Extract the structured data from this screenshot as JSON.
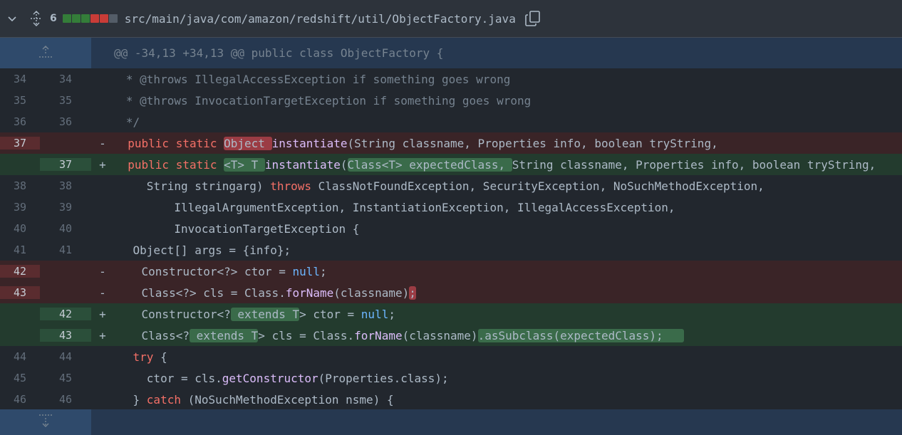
{
  "header": {
    "change_count": "6",
    "diffstat": [
      "#347d39",
      "#347d39",
      "#347d39",
      "#c93c37",
      "#c93c37",
      "#545d68"
    ],
    "file_path": "src/main/java/com/amazon/redshift/util/ObjectFactory.java",
    "icons": [
      "chevron-down-icon",
      "unfold-icon",
      "copy-icon"
    ]
  },
  "hunk": {
    "header": "@@ -34,13 +34,13 @@ public class ObjectFactory {",
    "expand_up_icon": "fold-up-icon",
    "expand_down_icon": "fold-down-icon"
  },
  "lines": {
    "l34": {
      "old": "34",
      "new": "34",
      "text": "   * @throws IllegalAccessException if something goes wrong"
    },
    "l35": {
      "old": "35",
      "new": "35",
      "text": "   * @throws InvocationTargetException if something goes wrong"
    },
    "l36": {
      "old": "36",
      "new": "36",
      "text": "   */"
    },
    "d37": {
      "old": "37",
      "marker": "-",
      "p1": "  public static ",
      "p2": "Object ",
      "p3": "instantiate",
      "p4": "(String classname, Properties info, boolean tryString,"
    },
    "a37": {
      "new": "37",
      "marker": "+",
      "p1": "  public static ",
      "p2": "<T> T ",
      "p3": "instantiate",
      "p4": "(",
      "p5": "Class<T> expectedClass, ",
      "p6": "String classname, Properties info, boolean tryString,"
    },
    "l38": {
      "old": "38",
      "new": "38",
      "p1": "      String stringarg) ",
      "p2": "throws",
      "p3": " ClassNotFoundException, SecurityException, NoSuchMethodException,"
    },
    "l39": {
      "old": "39",
      "new": "39",
      "text": "          IllegalArgumentException, InstantiationException, IllegalAccessException,"
    },
    "l40": {
      "old": "40",
      "new": "40",
      "text": "          InvocationTargetException {"
    },
    "l41": {
      "old": "41",
      "new": "41",
      "text": "    Object[] args = {info};"
    },
    "d42": {
      "old": "42",
      "marker": "-",
      "p1": "    Constructor<?> ctor = ",
      "p2": "null",
      "p3": ";"
    },
    "d43": {
      "old": "43",
      "marker": "-",
      "p1": "    Class<?> cls = Class.",
      "p2": "forName",
      "p3": "(classname)",
      "p4": ";"
    },
    "a42": {
      "new": "42",
      "marker": "+",
      "p1": "    Constructor<?",
      "p2": " extends T",
      "p3": "> ctor = ",
      "p4": "null",
      "p5": ";"
    },
    "a43": {
      "new": "43",
      "marker": "+",
      "p1": "    Class<?",
      "p2": " extends T",
      "p3": "> cls = Class.",
      "p4": "forName",
      "p5": "(classname)",
      "p6": ".asSubclass(expectedClass);   "
    },
    "l44": {
      "old": "44",
      "new": "44",
      "p1": "    ",
      "p2": "try",
      "p3": " {"
    },
    "l45": {
      "old": "45",
      "new": "45",
      "p1": "      ctor = cls.",
      "p2": "getConstructor",
      "p3": "(Properties.class);"
    },
    "l46": {
      "old": "46",
      "new": "46",
      "p1": "    } ",
      "p2": "catch",
      "p3": " (NoSuchMethodException nsme) {"
    }
  }
}
